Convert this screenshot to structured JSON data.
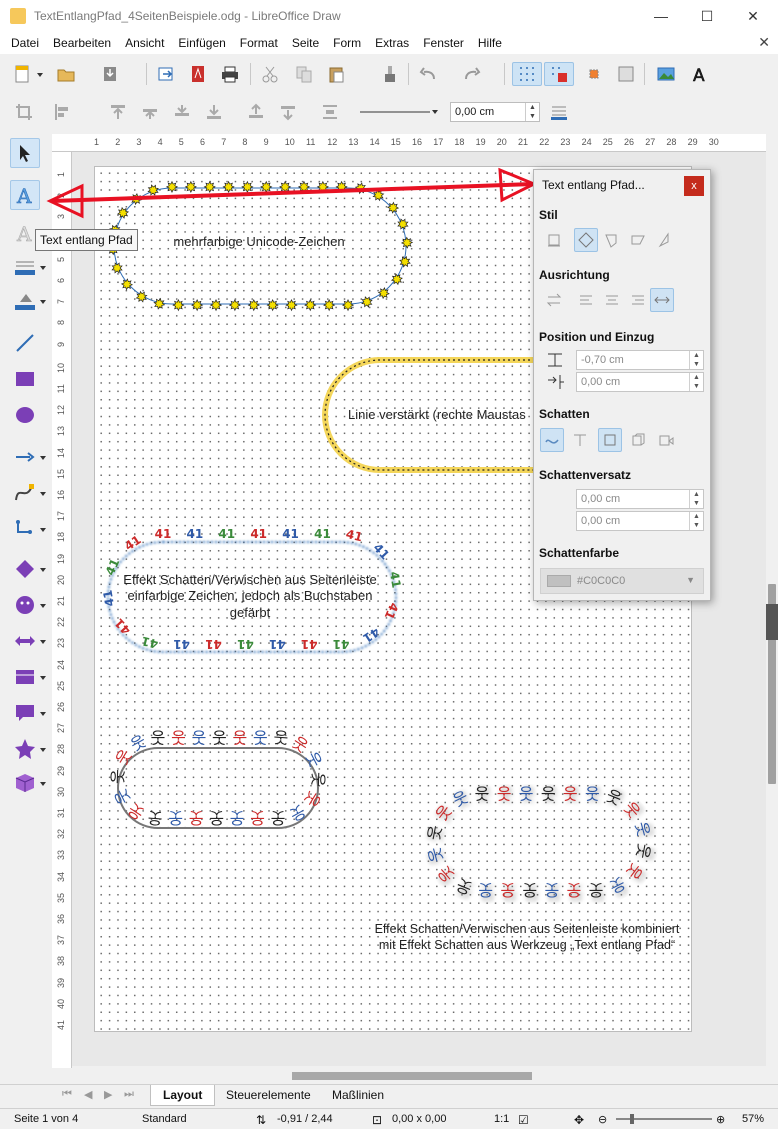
{
  "window": {
    "title": "TextEntlangPfad_4SeitenBeispiele.odg - LibreOffice Draw",
    "minimize_icon": "minimize-icon",
    "maximize_icon": "maximize-icon",
    "close_icon": "close-icon",
    "minimize_glyph": "—",
    "maximize_glyph": "☐",
    "close_glyph": "✕",
    "close_doc_glyph": "✕"
  },
  "menubar": [
    "Datei",
    "Bearbeiten",
    "Ansicht",
    "Einfügen",
    "Format",
    "Seite",
    "Form",
    "Extras",
    "Fenster",
    "Hilfe"
  ],
  "toolbar2": {
    "line_width_value": "0,00 cm"
  },
  "tooltip": "Text entlang Pfad",
  "canvas_shapes": {
    "shape1_text": "mehrfarbige Unicode-Zeichen",
    "shape2_text": "Linie verstärkt (rechte Maustas",
    "shape3_text": "Effekt Schatten/Verwischen aus Seitenleiste einfarbige Zeichen, jedoch als Buchstaben gefärbt",
    "shape4_caption": "Effekt Schatten/Verwischen aus Seitenleiste kombiniert mit Effekt Schatten aus Werkzeug „Text entlang Pfad“",
    "path_glyph_star": "✸",
    "path_glyph_41": "41",
    "path_glyph_korean": "웃",
    "path_glyph_x": "✕"
  },
  "panel": {
    "title": "Text entlang Pfad...",
    "close_glyph": "x",
    "section_stil": "Stil",
    "section_ausrichtung": "Ausrichtung",
    "section_position": "Position und Einzug",
    "position_value": "-0,70 cm",
    "einzug_value": "0,00 cm",
    "section_schatten": "Schatten",
    "section_schattenversatz": "Schattenversatz",
    "versatz_x": "0,00 cm",
    "versatz_y": "0,00 cm",
    "section_schattenfarbe": "Schattenfarbe",
    "schattenfarbe_value": "#C0C0C0",
    "schattenfarbe_color": "#C0C0C0",
    "spin_up": "▲",
    "spin_down": "▼"
  },
  "ruler": {
    "h_ticks": [
      "1",
      "2",
      "3",
      "4",
      "5",
      "6",
      "7",
      "8",
      "9",
      "10",
      "11",
      "12",
      "13",
      "14",
      "15",
      "16",
      "17",
      "18",
      "19",
      "20",
      "21",
      "22",
      "23",
      "24",
      "25",
      "26",
      "27",
      "28",
      "29",
      "30"
    ],
    "v_ticks": [
      "1",
      "2",
      "3",
      "4",
      "5",
      "6",
      "7",
      "8",
      "9",
      "10",
      "11",
      "12",
      "13",
      "14",
      "15",
      "16",
      "17",
      "18",
      "19",
      "20",
      "21",
      "22",
      "23",
      "24",
      "25",
      "26",
      "27",
      "28",
      "29",
      "30",
      "31",
      "32",
      "33",
      "34",
      "35",
      "36",
      "37",
      "38",
      "39",
      "40",
      "41"
    ]
  },
  "tabs": [
    "Layout",
    "Steuerelemente",
    "Maßlinien"
  ],
  "statusbar": {
    "page": "Seite 1 von 4",
    "style": "Standard",
    "position": "-0,91 / 2,44",
    "size": "0,00 x 0,00",
    "ratio": "1:1",
    "zoom": "57%"
  },
  "colors": {
    "accent_red": "#e81123",
    "star_yellow": "#f5e000",
    "path_blue": "#2f6db5",
    "text41_red": "#cc2a2a",
    "text41_green": "#3a8a3a",
    "text41_blue": "#2f5aa8"
  }
}
